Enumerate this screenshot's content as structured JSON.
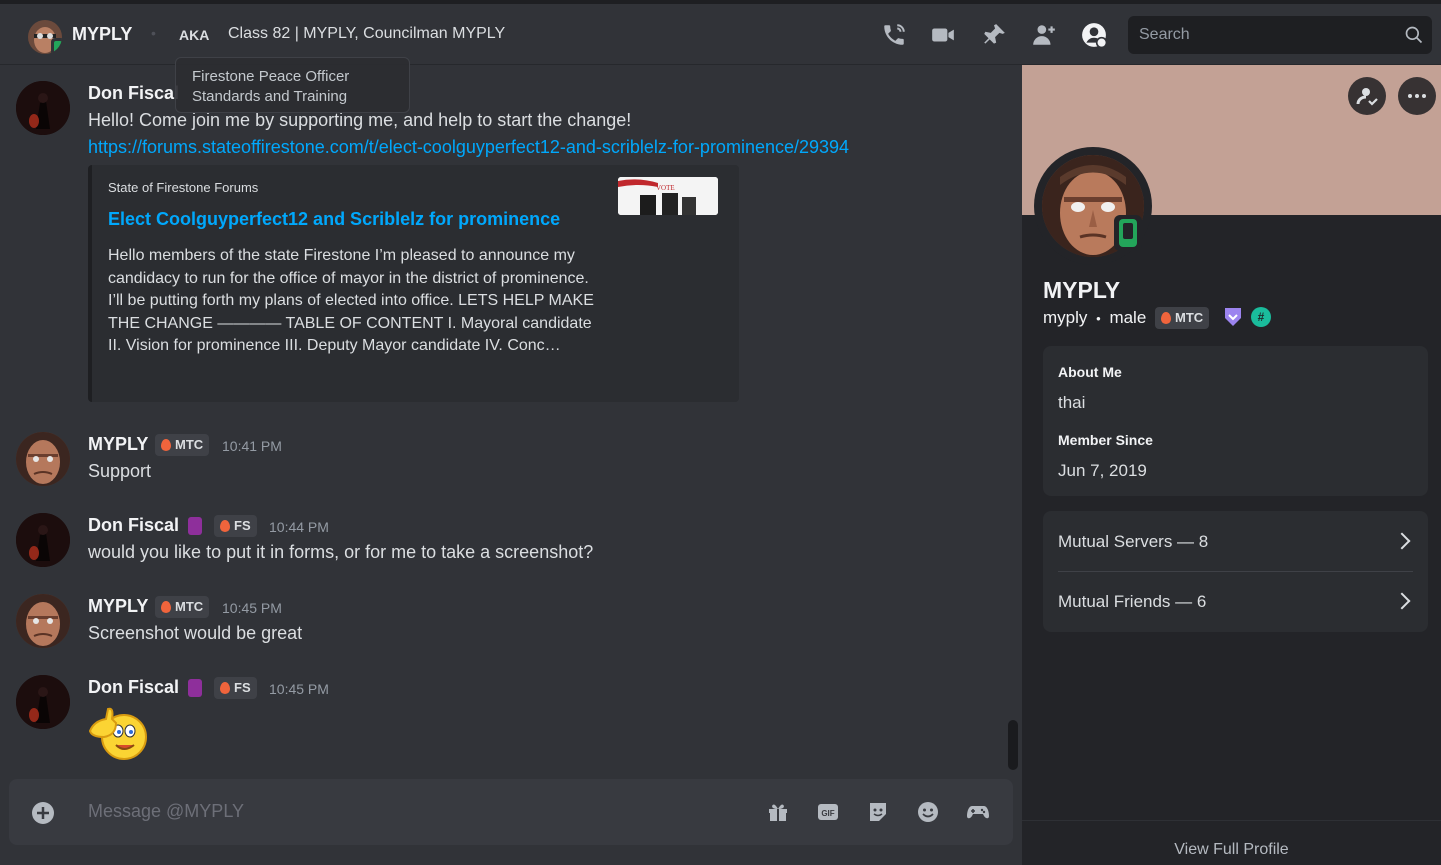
{
  "header": {
    "name": "MYPLY",
    "aka_label": "AKA",
    "nicknames": "Class 82 | MYPLY, Councilman MYPLY",
    "search_placeholder": "Search",
    "icons": [
      "voice-call-icon",
      "video-call-icon",
      "pin-icon",
      "add-friends-icon",
      "user-profile-icon",
      "search-icon"
    ]
  },
  "tooltip": {
    "line1": "Firestone Peace Officer",
    "line2": "Standards and Training"
  },
  "messages": [
    {
      "author": "Don Fiscal",
      "text": "Hello! Come join me by supporting me, and help to start the change!",
      "link": "https://forums.stateoffirestone.com/t/elect-coolguyperfect12-and-scriblelz-for-prominence/29394",
      "embed": {
        "provider": "State of Firestone Forums",
        "title": "Elect Coolguyperfect12 and Scriblelz for prominence",
        "description": "Hello members of the state Firestone I’m pleased to announce my candidacy to run for the office of mayor in the district of prominence. I’ll be putting forth my plans of elected into office. LETS HELP MAKE THE CHANGE ———— TABLE OF CONTENT I. Mayoral candidate II. Vision for prominence III. Deputy Mayor candidate IV. Conc…",
        "thumb_text": "VOTE"
      }
    },
    {
      "author": "MYPLY",
      "badge": "MTC",
      "time": "10:41 PM",
      "text": "Support"
    },
    {
      "author": "Don Fiscal",
      "badge": "FS",
      "time": "10:44 PM",
      "text": "would you like to put it in forms, or for me to take a screenshot?"
    },
    {
      "author": "MYPLY",
      "badge": "MTC",
      "time": "10:45 PM",
      "text": "Screenshot would be great"
    },
    {
      "author": "Don Fiscal",
      "badge": "FS",
      "time": "10:45 PM",
      "text": ""
    }
  ],
  "composer": {
    "placeholder": "Message @MYPLY",
    "icons": [
      "gift-icon",
      "gif-icon",
      "sticker-icon",
      "emoji-icon",
      "game-controller-icon"
    ],
    "gif_label": "GIF"
  },
  "profile": {
    "display_name": "MYPLY",
    "username": "myply",
    "separator": "•",
    "pronouns": "male",
    "badge": "MTC",
    "hash_badge": "#",
    "about_label": "About Me",
    "about_text": "thai",
    "member_since_label": "Member Since",
    "member_since": "Jun 7, 2019",
    "mutual_servers": "Mutual Servers — 8",
    "mutual_friends": "Mutual Friends — 6",
    "view_full_profile": "View Full Profile",
    "banner_color": "#c3a195"
  },
  "colors": {
    "accent_link": "#00a8fc",
    "online": "#23a55a",
    "background": "#313338",
    "panel": "#232428"
  }
}
